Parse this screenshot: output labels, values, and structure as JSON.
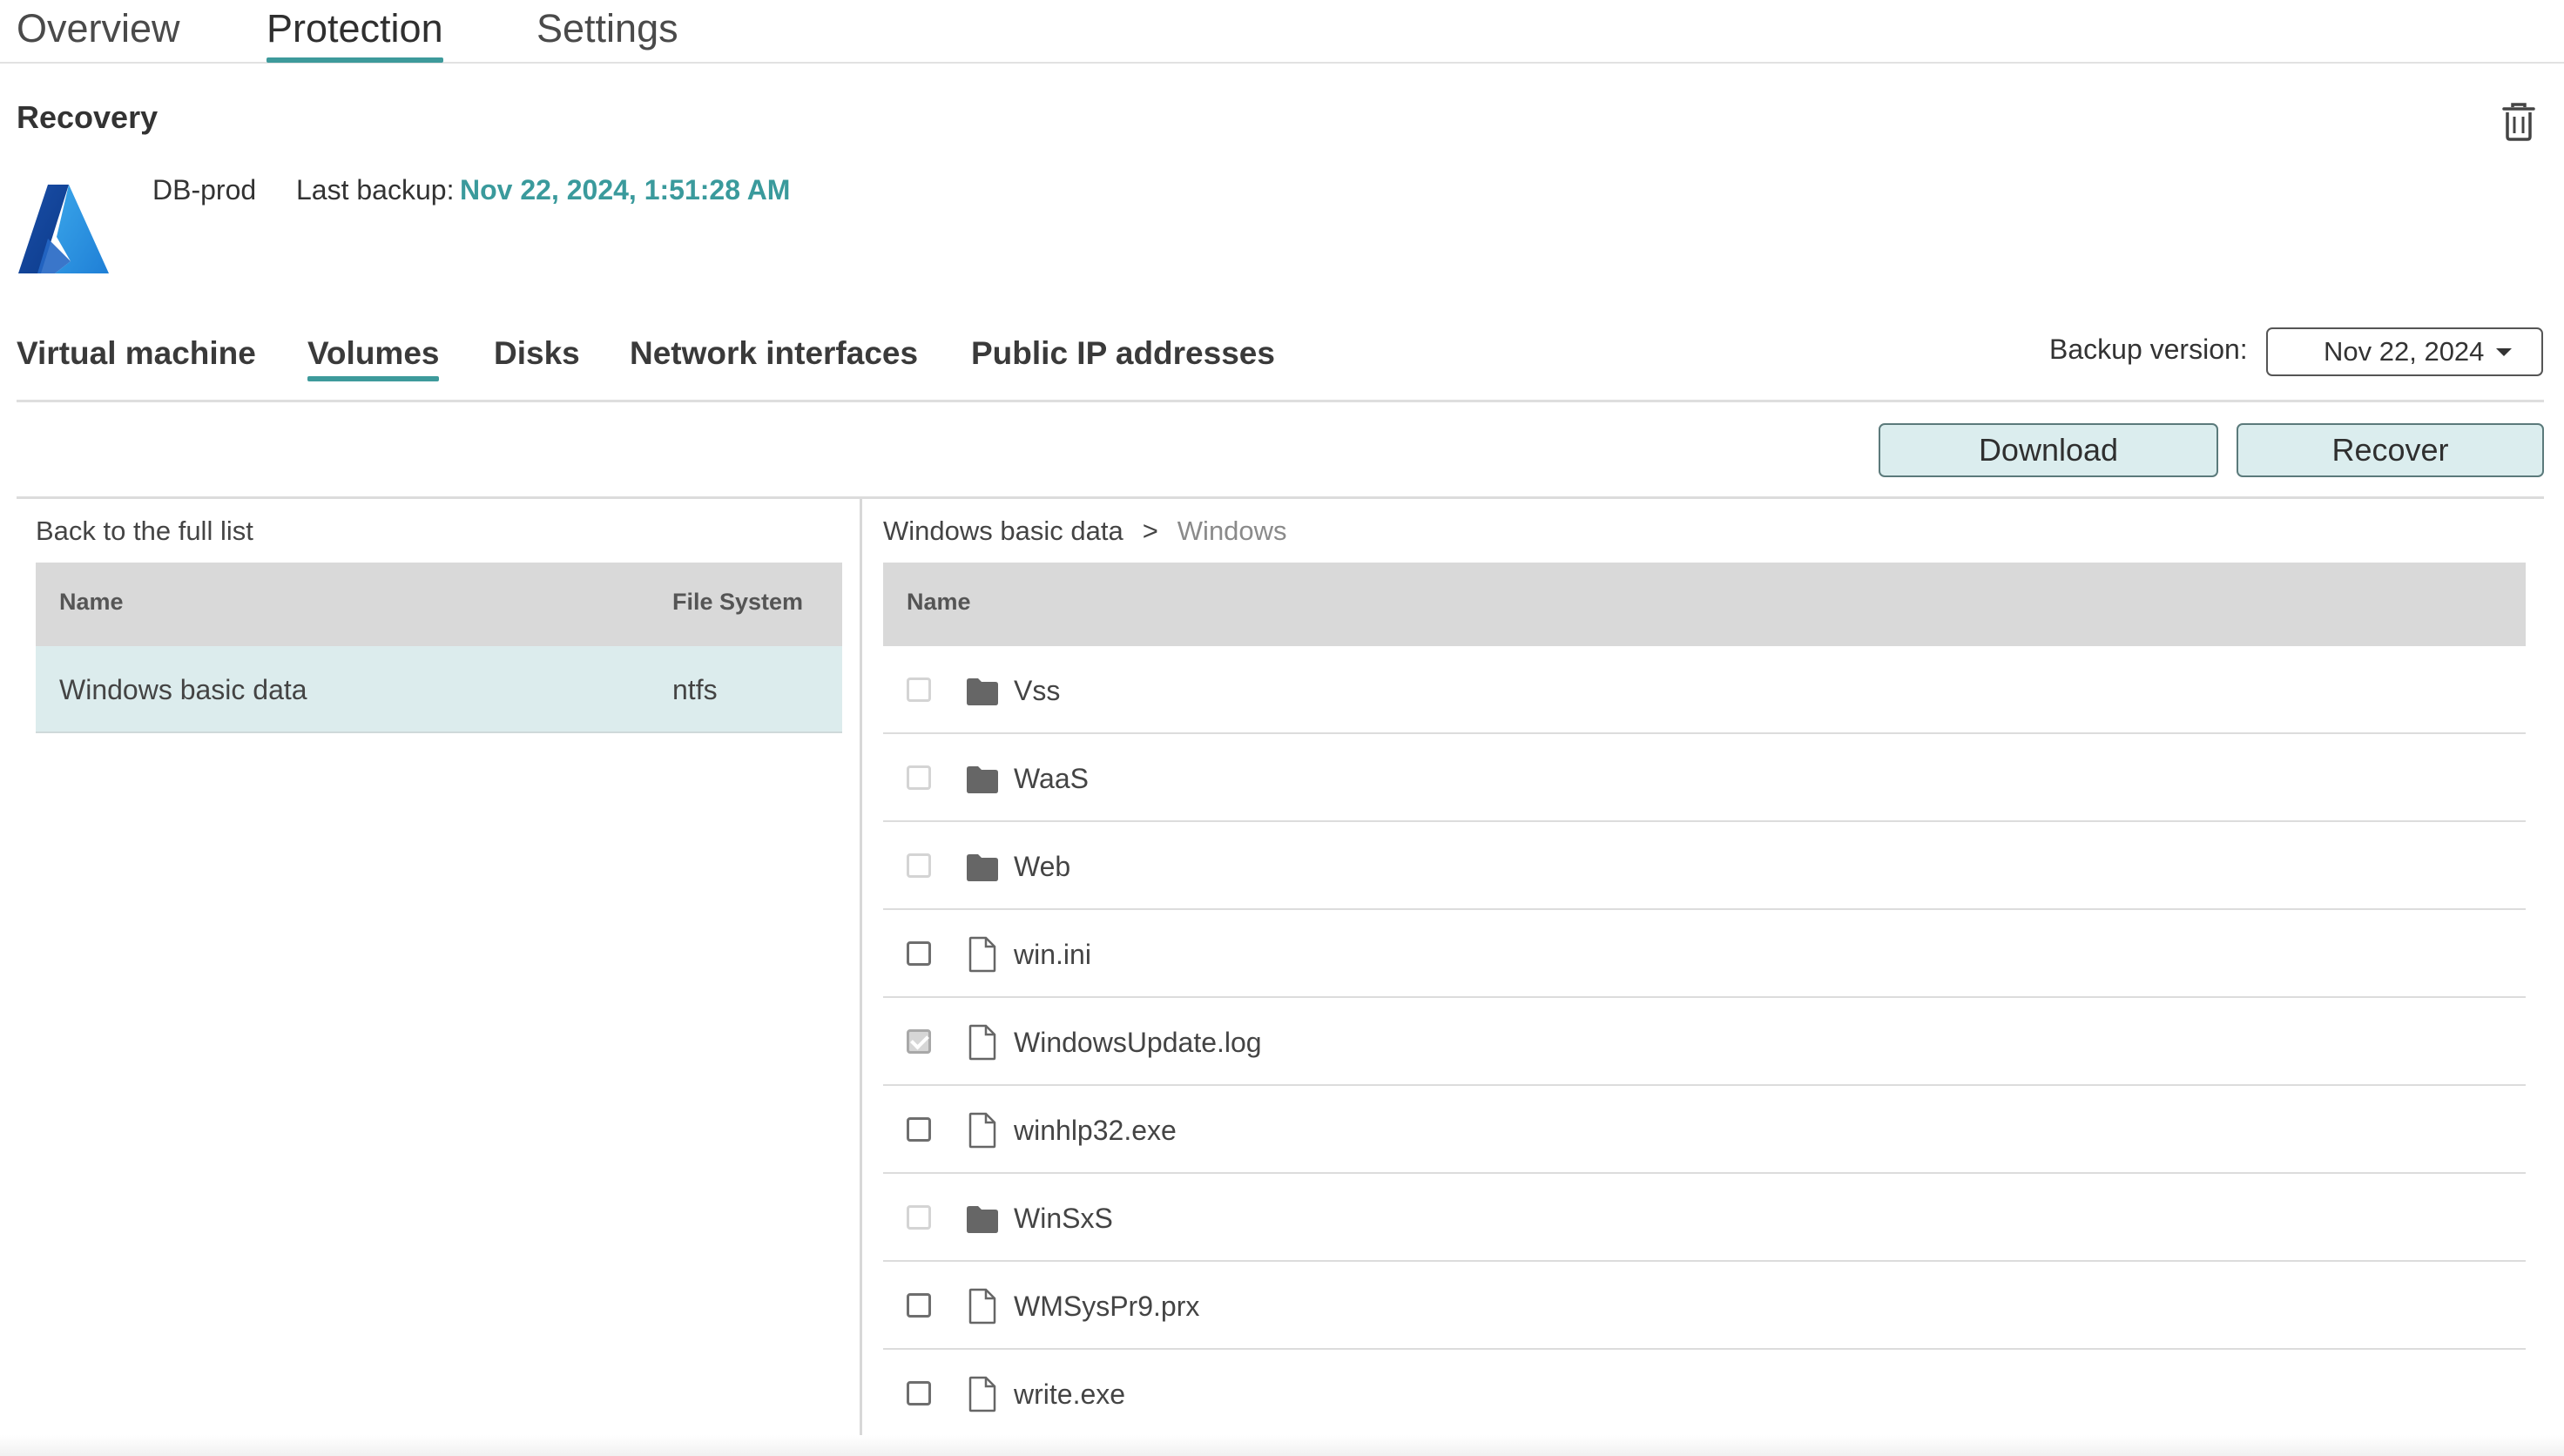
{
  "top_tabs": [
    {
      "label": "Overview"
    },
    {
      "label": "Protection"
    },
    {
      "label": "Settings"
    }
  ],
  "top_tabs_active": "Protection",
  "recovery": {
    "title": "Recovery",
    "vm_name": "DB-prod",
    "last_backup_label": "Last backup:",
    "last_backup_value": "Nov 22, 2024, 1:51:28 AM",
    "logo_icon": "azure-logo-icon",
    "delete_icon": "trash-icon"
  },
  "sub_tabs": [
    {
      "label": "Virtual machine"
    },
    {
      "label": "Volumes"
    },
    {
      "label": "Disks"
    },
    {
      "label": "Network interfaces"
    },
    {
      "label": "Public IP addresses"
    }
  ],
  "sub_tabs_active": "Volumes",
  "backup_version": {
    "label": "Backup version:",
    "value": "Nov 22, 2024"
  },
  "actions": {
    "download": "Download",
    "recover": "Recover"
  },
  "volumes": {
    "back_link": "Back to the full list",
    "columns": {
      "name": "Name",
      "file_system": "File System"
    },
    "rows": [
      {
        "name": "Windows basic data",
        "file_system": "ntfs",
        "selected": true
      }
    ]
  },
  "browser": {
    "breadcrumb": {
      "root": "Windows basic data",
      "separator": ">",
      "current": "Windows"
    },
    "columns": {
      "name": "Name"
    },
    "items": [
      {
        "name": "Vss",
        "type": "folder",
        "checkbox": "disabled"
      },
      {
        "name": "WaaS",
        "type": "folder",
        "checkbox": "disabled"
      },
      {
        "name": "Web",
        "type": "folder",
        "checkbox": "disabled"
      },
      {
        "name": "win.ini",
        "type": "file",
        "checkbox": "unchecked"
      },
      {
        "name": "WindowsUpdate.log",
        "type": "file",
        "checkbox": "checked"
      },
      {
        "name": "winhlp32.exe",
        "type": "file",
        "checkbox": "unchecked"
      },
      {
        "name": "WinSxS",
        "type": "folder",
        "checkbox": "disabled"
      },
      {
        "name": "WMSysPr9.prx",
        "type": "file",
        "checkbox": "unchecked"
      },
      {
        "name": "write.exe",
        "type": "file",
        "checkbox": "unchecked"
      }
    ]
  },
  "colors": {
    "accent": "#3d9a9b",
    "selected_row": "#dceced",
    "header_bg": "#d9d9d9"
  }
}
